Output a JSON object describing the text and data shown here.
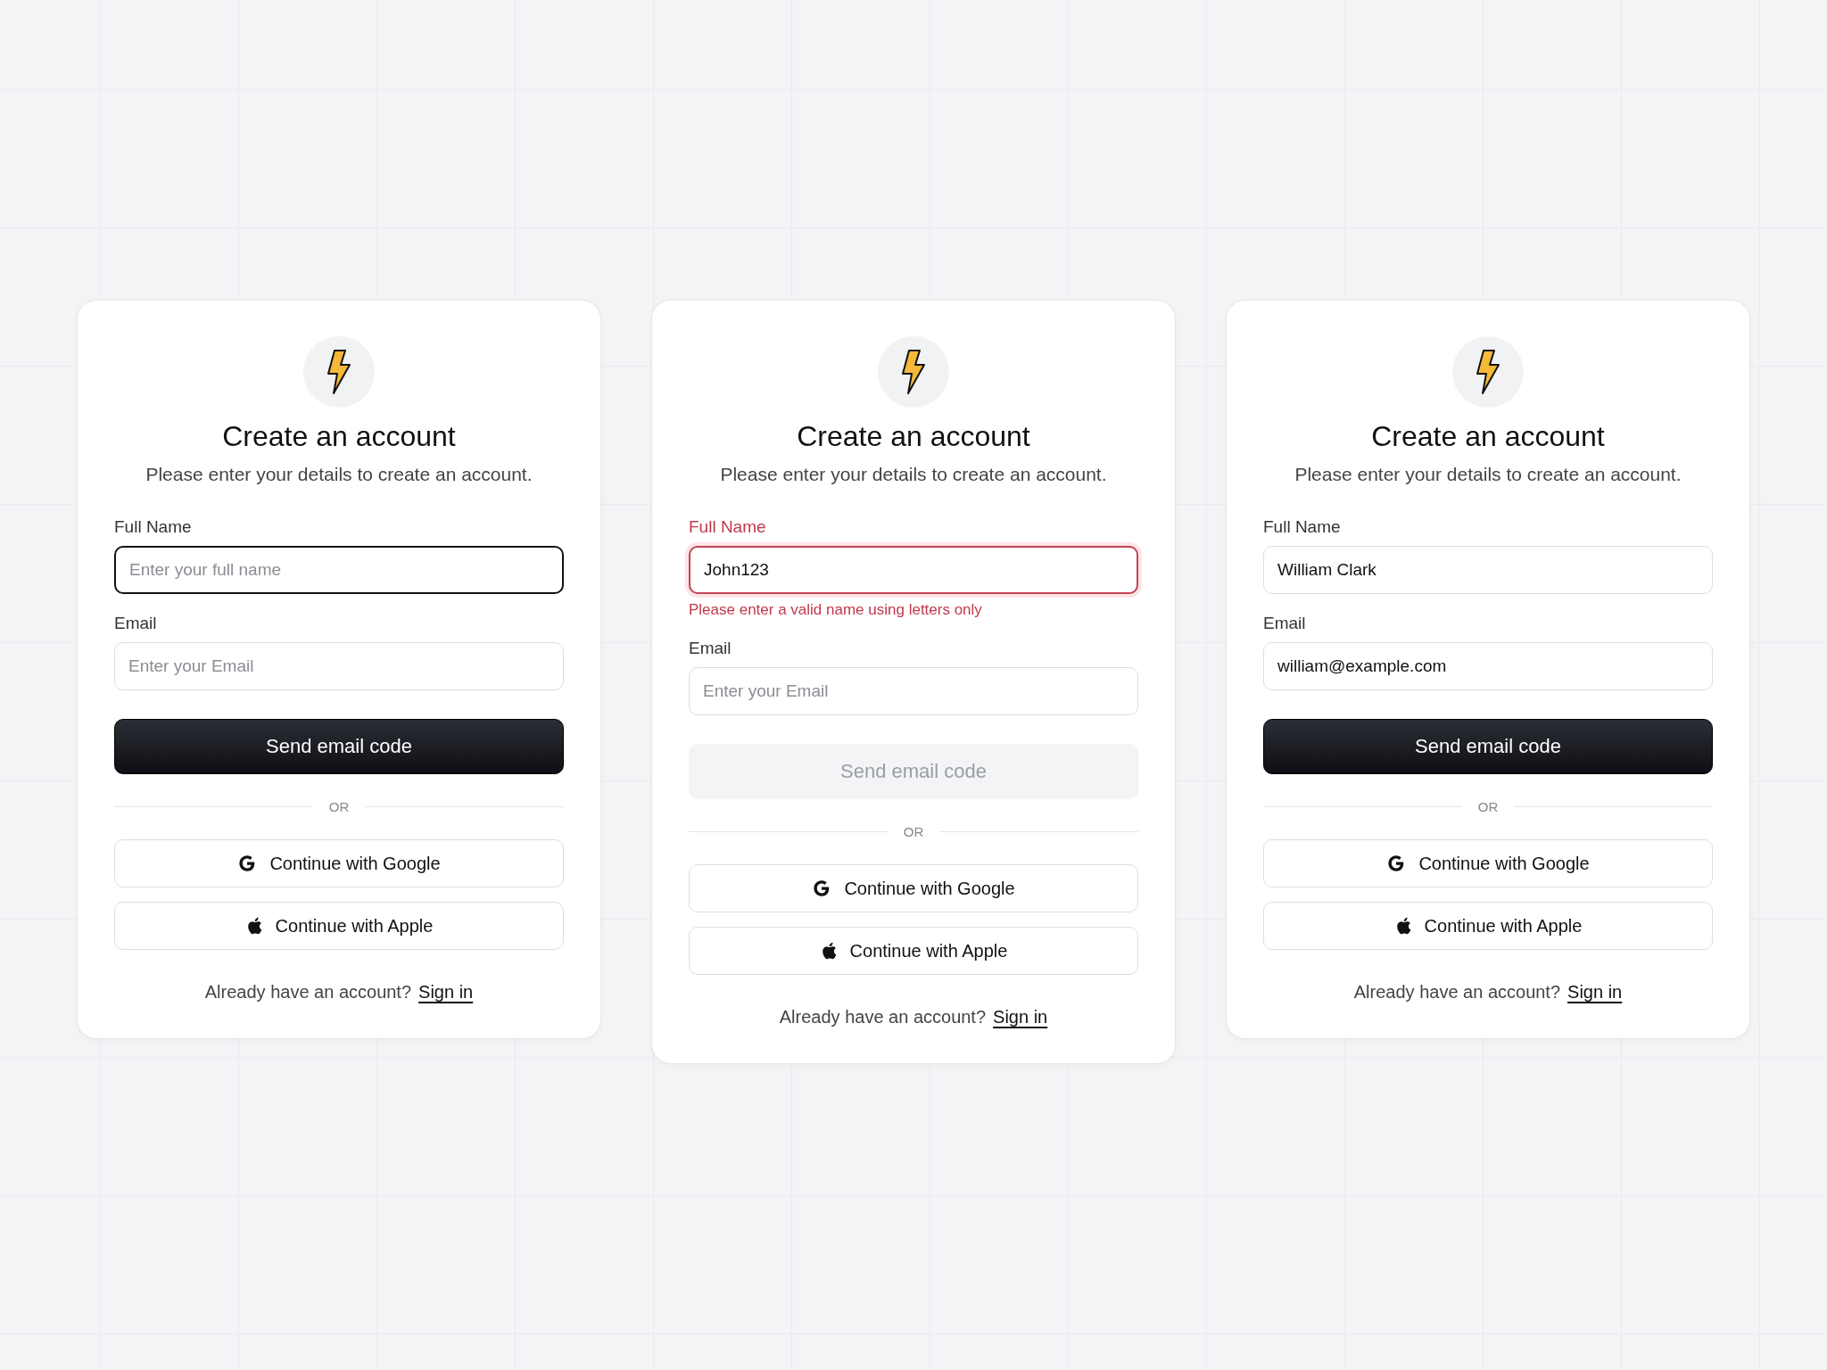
{
  "cards": [
    {
      "title": "Create an account",
      "subtitle": "Please enter your details to create an account.",
      "fields": [
        {
          "label": "Full Name",
          "placeholder": "Enter your full name",
          "focused": true,
          "invalid": false
        },
        {
          "label": "Email",
          "placeholder": "Enter your Email",
          "focused": false,
          "invalid": false
        }
      ],
      "submit": {
        "label": "Send email code",
        "disabled": false
      },
      "divider": "OR",
      "social": [
        {
          "kind": "google",
          "label": "Continue with Google"
        },
        {
          "kind": "apple",
          "label": "Continue with Apple"
        }
      ],
      "footer": {
        "text": "Already have an account?",
        "link": "Sign in"
      }
    },
    {
      "title": "Create an account",
      "subtitle": "Please enter your details to create an account.",
      "fields": [
        {
          "label": "Full Name",
          "value": "John123",
          "focused": true,
          "invalid": true,
          "error": "Please enter a valid name using letters only"
        },
        {
          "label": "Email",
          "placeholder": "Enter your Email",
          "focused": false,
          "invalid": false
        }
      ],
      "submit": {
        "label": "Send email code",
        "disabled": true
      },
      "divider": "OR",
      "social": [
        {
          "kind": "google",
          "label": "Continue with Google"
        },
        {
          "kind": "apple",
          "label": "Continue with Apple"
        }
      ],
      "footer": {
        "text": "Already have an account?",
        "link": "Sign in"
      }
    },
    {
      "title": "Create an account",
      "subtitle": "Please enter your details to create an account.",
      "fields": [
        {
          "label": "Full Name",
          "value": "William Clark",
          "focused": false,
          "invalid": false
        },
        {
          "label": "Email",
          "value": "william@example.com",
          "focused": false,
          "invalid": false
        }
      ],
      "submit": {
        "label": "Send email code",
        "disabled": false
      },
      "divider": "OR",
      "social": [
        {
          "kind": "google",
          "label": "Continue with Google"
        },
        {
          "kind": "apple",
          "label": "Continue with Apple"
        }
      ],
      "footer": {
        "text": "Already have an account?",
        "link": "Sign in"
      }
    }
  ]
}
